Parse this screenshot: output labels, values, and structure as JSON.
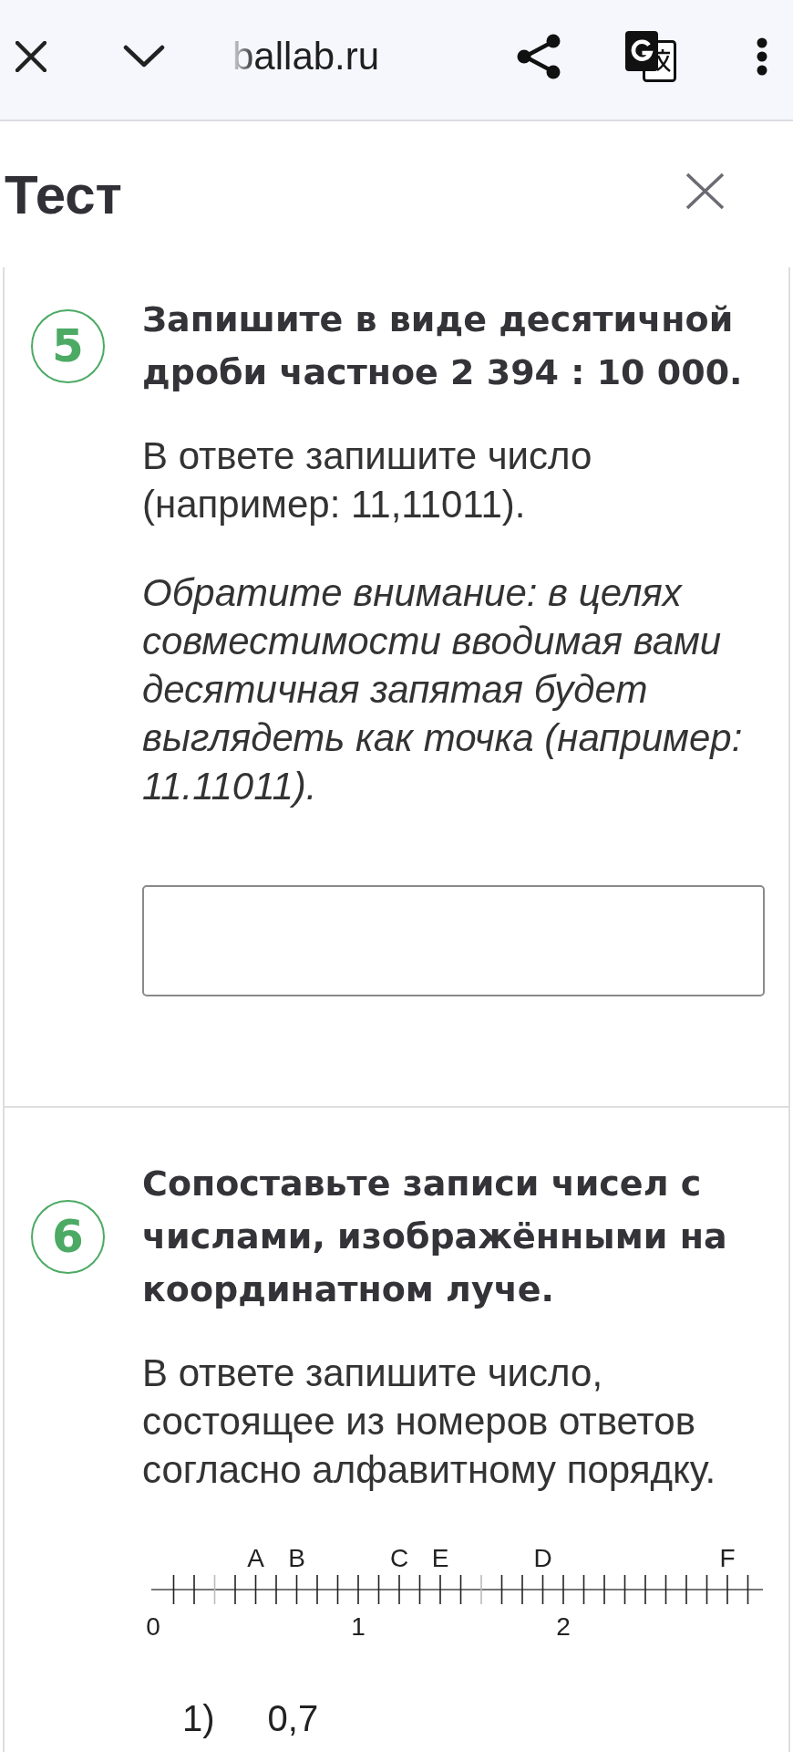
{
  "browser_bar": {
    "url": "ballab.ru"
  },
  "header": {
    "title": "Тест"
  },
  "questions": [
    {
      "number": "5",
      "kind": "short_answer",
      "title": "Запишите в виде десятичной дроби частное 2 394 : 10 000.",
      "paragraphs": [
        {
          "kind": "instruction",
          "text": "В ответе запишите число (например: 11,11011)."
        },
        {
          "kind": "note",
          "text": "Обратите внимание: в целях совместимости вводимая вами десятичная запятая будет выглядеть как точка (например: 11.11011)."
        }
      ]
    },
    {
      "number": "6",
      "kind": "matching",
      "title": "Сопоставьте записи чисел с числами, изображёнными на координатном луче.",
      "paragraphs": [
        {
          "kind": "instruction",
          "text": "В ответе запишите число, состоящее из номеров ответов согласно алфавитному порядку."
        }
      ],
      "number_line": {
        "points": [
          {
            "label": "A"
          },
          {
            "label": "B"
          },
          {
            "label": "C"
          },
          {
            "label": "E"
          },
          {
            "label": "D"
          },
          {
            "label": "F"
          }
        ],
        "scale_labels": [
          {
            "label": "0"
          },
          {
            "label": "1"
          },
          {
            "label": "2"
          }
        ]
      },
      "options": [
        {
          "number": "1)",
          "value": "0,7"
        }
      ]
    }
  ]
}
